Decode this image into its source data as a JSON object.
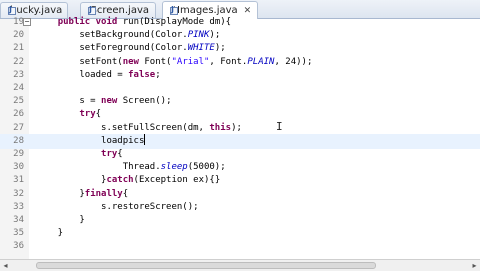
{
  "tabs": [
    {
      "label": "bucky.java",
      "close": "",
      "active": false
    },
    {
      "label": "Screen.java",
      "close": "",
      "active": false
    },
    {
      "label": "*Images.java",
      "close": "✕",
      "active": true
    }
  ],
  "editor": {
    "lines": [
      {
        "num": "19",
        "fold": "−",
        "segments": [
          {
            "t": "    "
          },
          {
            "t": "public",
            "c": "kw"
          },
          {
            "t": " "
          },
          {
            "t": "void",
            "c": "kw"
          },
          {
            "t": " run(DisplayMode dm){"
          }
        ]
      },
      {
        "num": "20",
        "segments": [
          {
            "t": "        setBackground(Color."
          },
          {
            "t": "PINK",
            "c": "stat"
          },
          {
            "t": ");"
          }
        ]
      },
      {
        "num": "21",
        "segments": [
          {
            "t": "        setForeground(Color."
          },
          {
            "t": "WHITE",
            "c": "stat"
          },
          {
            "t": ");"
          }
        ]
      },
      {
        "num": "22",
        "segments": [
          {
            "t": "        setFont("
          },
          {
            "t": "new",
            "c": "kw"
          },
          {
            "t": " Font("
          },
          {
            "t": "\"Arial\"",
            "c": "str"
          },
          {
            "t": ", Font."
          },
          {
            "t": "PLAIN",
            "c": "stat"
          },
          {
            "t": ", 24));"
          }
        ]
      },
      {
        "num": "23",
        "segments": [
          {
            "t": "        loaded = "
          },
          {
            "t": "false",
            "c": "kw"
          },
          {
            "t": ";"
          }
        ]
      },
      {
        "num": "24",
        "segments": [
          {
            "t": ""
          }
        ]
      },
      {
        "num": "25",
        "segments": [
          {
            "t": "        s = "
          },
          {
            "t": "new",
            "c": "kw"
          },
          {
            "t": " Screen();"
          }
        ]
      },
      {
        "num": "26",
        "segments": [
          {
            "t": "        "
          },
          {
            "t": "try",
            "c": "kw"
          },
          {
            "t": "{"
          }
        ]
      },
      {
        "num": "27",
        "segments": [
          {
            "t": "            s.setFullScreen(dm, "
          },
          {
            "t": "this",
            "c": "kw"
          },
          {
            "t": ");"
          }
        ]
      },
      {
        "num": "28",
        "current": true,
        "segments": [
          {
            "t": "            loadpics"
          }
        ]
      },
      {
        "num": "29",
        "segments": [
          {
            "t": "            "
          },
          {
            "t": "try",
            "c": "kw"
          },
          {
            "t": "{"
          }
        ]
      },
      {
        "num": "30",
        "segments": [
          {
            "t": "                Thread."
          },
          {
            "t": "sleep",
            "c": "stat"
          },
          {
            "t": "(5000);"
          }
        ]
      },
      {
        "num": "31",
        "segments": [
          {
            "t": "            }"
          },
          {
            "t": "catch",
            "c": "kw"
          },
          {
            "t": "(Exception ex){}"
          }
        ]
      },
      {
        "num": "32",
        "segments": [
          {
            "t": "        }"
          },
          {
            "t": "finally",
            "c": "kw"
          },
          {
            "t": "{"
          }
        ]
      },
      {
        "num": "33",
        "segments": [
          {
            "t": "            s.restoreScreen();"
          }
        ]
      },
      {
        "num": "34",
        "segments": [
          {
            "t": "        }"
          }
        ]
      },
      {
        "num": "35",
        "segments": [
          {
            "t": "    }"
          }
        ]
      },
      {
        "num": "36",
        "segments": [
          {
            "t": ""
          }
        ]
      }
    ]
  },
  "scrollbar": {
    "left_arrow": "◂",
    "right_arrow": "▸"
  }
}
